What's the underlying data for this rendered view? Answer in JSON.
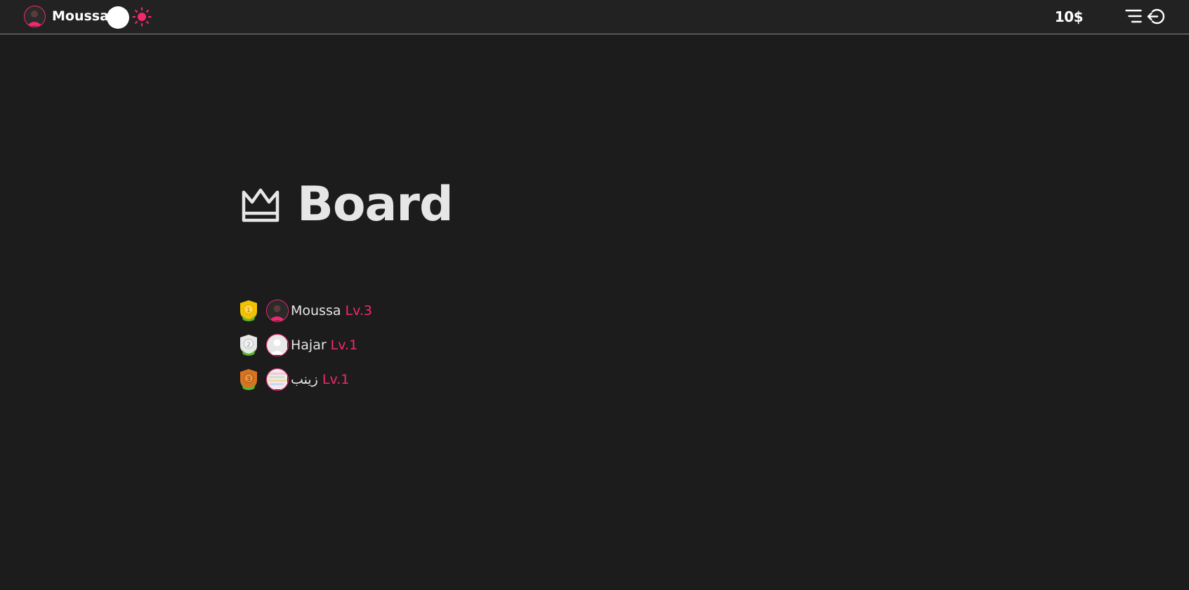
{
  "header": {
    "username": "Moussa",
    "balance": "10$",
    "accent_color": "#f0296e",
    "icons": {
      "theme_toggle": "toggle-knob",
      "theme": "sun-icon",
      "menu": "menu-icon",
      "logout": "logout-icon"
    }
  },
  "board": {
    "title": "Board",
    "icon": "crown-icon",
    "rows": [
      {
        "rank": "1",
        "name": "Moussa",
        "level": "Lv.3",
        "medal_color": "#f2c200"
      },
      {
        "rank": "2",
        "name": "Hajar",
        "level": "Lv.1",
        "medal_color": "#e8e8e8"
      },
      {
        "rank": "3",
        "name": "زينب",
        "level": "Lv.1",
        "medal_color": "#d87420"
      }
    ]
  }
}
